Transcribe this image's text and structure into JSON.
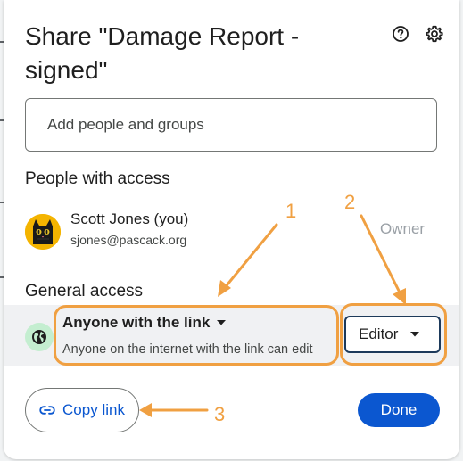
{
  "dialog": {
    "title": "Share \"Damage Report - signed\"",
    "help_icon": "help-icon",
    "settings_icon": "gear-icon"
  },
  "add_people": {
    "placeholder": "Add people and groups"
  },
  "people_section": {
    "heading": "People with access",
    "people": [
      {
        "name": "Scott Jones (you)",
        "email": "sjones@pascack.org",
        "role": "Owner",
        "avatar_icon": "black-cat-avatar"
      }
    ]
  },
  "general_access": {
    "heading": "General access",
    "icon": "globe-icon",
    "option": "Anyone with the link",
    "description": "Anyone on the internet with the link can edit",
    "role": "Editor"
  },
  "footer": {
    "copy_link_label": "Copy link",
    "copy_link_icon": "link-icon",
    "done_label": "Done"
  },
  "annotations": {
    "labels": [
      "1",
      "2",
      "3"
    ],
    "color": "#f0a042"
  },
  "colors": {
    "primary": "#0b57d0",
    "highlight_row": "#f0f1f3",
    "globe_bg": "#c4eed0",
    "role_border": "#1d3a5b"
  }
}
